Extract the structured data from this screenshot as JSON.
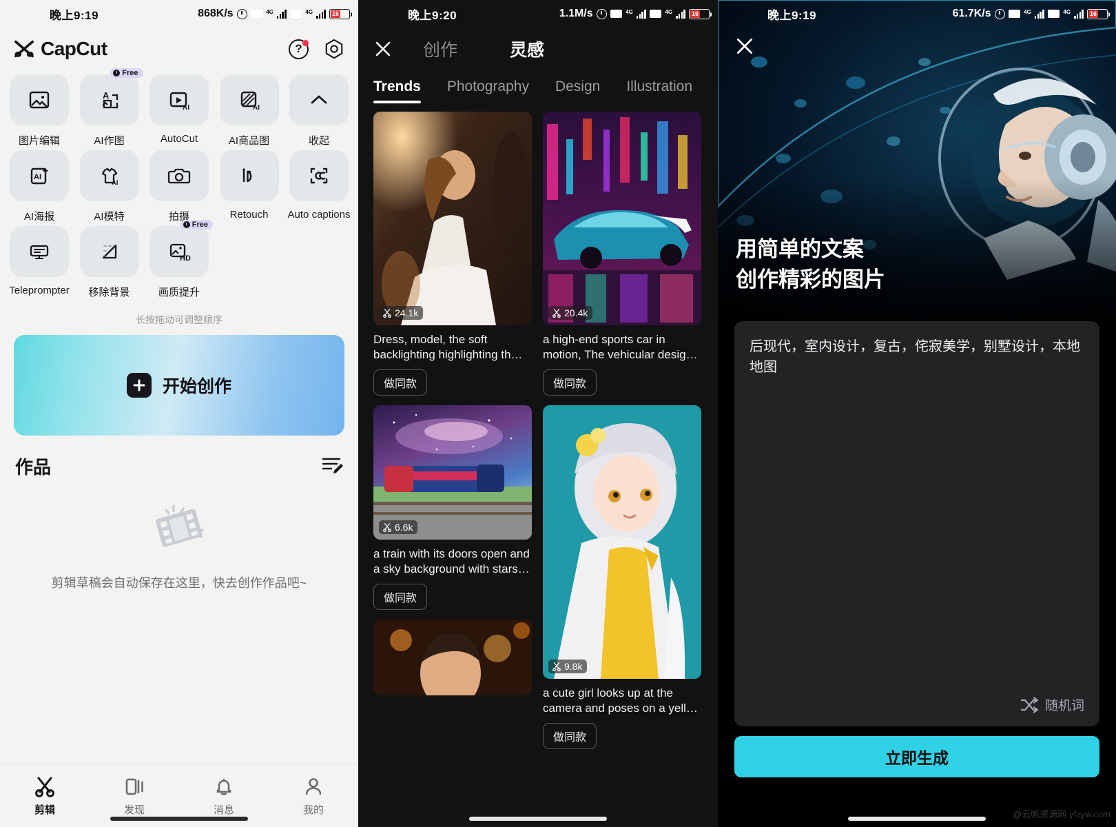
{
  "panel1": {
    "status": {
      "time": "晚上9:19",
      "speed": "868K/s",
      "battery": "16",
      "net": "4G",
      "hd": "HD"
    },
    "header": {
      "app_name": "CapCut",
      "logo_icon": "capcut-logo-icon",
      "help_icon": "help-circle-icon",
      "settings_icon": "gear-hex-icon"
    },
    "tools": {
      "rows": [
        [
          {
            "label": "图片编辑",
            "icon": "image-edit-icon",
            "badge": ""
          },
          {
            "label": "AI作图",
            "icon": "ai-text-to-image-icon",
            "badge": "Free"
          },
          {
            "label": "AutoCut",
            "icon": "autocut-play-ai-icon",
            "badge": ""
          },
          {
            "label": "AI商品图",
            "icon": "ai-product-image-icon",
            "badge": ""
          },
          {
            "label": "收起",
            "icon": "chevron-up-icon",
            "badge": ""
          }
        ],
        [
          {
            "label": "AI海报",
            "icon": "ai-poster-icon",
            "badge": ""
          },
          {
            "label": "AI模特",
            "icon": "ai-model-shirt-icon",
            "badge": ""
          },
          {
            "label": "拍摄",
            "icon": "camera-icon",
            "badge": ""
          },
          {
            "label": "Retouch",
            "icon": "retouch-icon",
            "badge": ""
          },
          {
            "label": "Auto captions",
            "icon": "auto-captions-icon",
            "badge": ""
          }
        ],
        [
          {
            "label": "Teleprompter",
            "icon": "teleprompter-icon",
            "badge": ""
          },
          {
            "label": "移除背景",
            "icon": "remove-background-icon",
            "badge": ""
          },
          {
            "label": "画质提升",
            "icon": "hd-upscale-icon",
            "badge": "Free"
          }
        ]
      ],
      "drag_hint": "长按拖动可调整顺序"
    },
    "cta": {
      "label": "开始创作",
      "icon": "plus-square-icon"
    },
    "works": {
      "title": "作品",
      "menu_icon": "edit-list-icon",
      "empty_icon": "film-strip-icon",
      "empty_text": "剪辑草稿会自动保存在这里，快去创作作品吧~"
    },
    "tabbar": [
      {
        "label": "剪辑",
        "icon": "scissors-icon",
        "active": true
      },
      {
        "label": "发现",
        "icon": "discover-cards-icon",
        "active": false
      },
      {
        "label": "消息",
        "icon": "bell-icon",
        "active": false
      },
      {
        "label": "我的",
        "icon": "person-icon",
        "active": false
      }
    ]
  },
  "panel2": {
    "status": {
      "time": "晚上9:20",
      "speed": "1.1M/s",
      "battery": "16",
      "net": "4G",
      "hd": "HD"
    },
    "nav": {
      "close_icon": "close-x-icon",
      "tabs": [
        {
          "label": "创作",
          "active": false
        },
        {
          "label": "灵感",
          "active": true
        }
      ]
    },
    "categories": [
      {
        "label": "Trends",
        "active": true
      },
      {
        "label": "Photography",
        "active": false
      },
      {
        "label": "Design",
        "active": false
      },
      {
        "label": "Illustration",
        "active": false
      }
    ],
    "make_same_label": "做同款",
    "uses_icon": "scissors-icon",
    "cards_left": [
      {
        "uses": "24.1k",
        "caption": "Dress, model, the soft backlighting highlighting th…",
        "image": "woman-in-white-dress-golden-backlight"
      },
      {
        "uses": "6.6k",
        "caption": "a train with its doors open and a sky background with stars …",
        "image": "train-under-starry-galaxy-sky"
      },
      {
        "uses": "",
        "caption": "",
        "image": "man-portrait-warm-bokeh"
      }
    ],
    "cards_right": [
      {
        "uses": "20.4k",
        "caption": "a high-end sports car in motion, The vehicular desig…",
        "image": "neon-city-sports-car"
      },
      {
        "uses": "9.8k",
        "caption": "a cute girl looks up at the camera and poses on a yell…",
        "image": "anime-girl-yellow-outfit-teal-background"
      }
    ]
  },
  "panel3": {
    "status": {
      "time": "晚上9:19",
      "speed": "61.7K/s",
      "battery": "16",
      "net": "4G",
      "hd": "HD"
    },
    "close_icon": "close-x-icon",
    "hero_image": "cyber-girl-headphones-underwater-bubbles",
    "title_line1": "用简单的文案",
    "title_line2": "创作精彩的图片",
    "prompt_value": "后现代，室内设计，复古，侘寂美学，别墅设计，本地地图",
    "random_word": {
      "label": "随机词",
      "icon": "shuffle-icon"
    },
    "generate_label": "立即生成",
    "accent_color": "#2fd2e4",
    "watermark": "@云帆资源网 yfzyw.com"
  }
}
